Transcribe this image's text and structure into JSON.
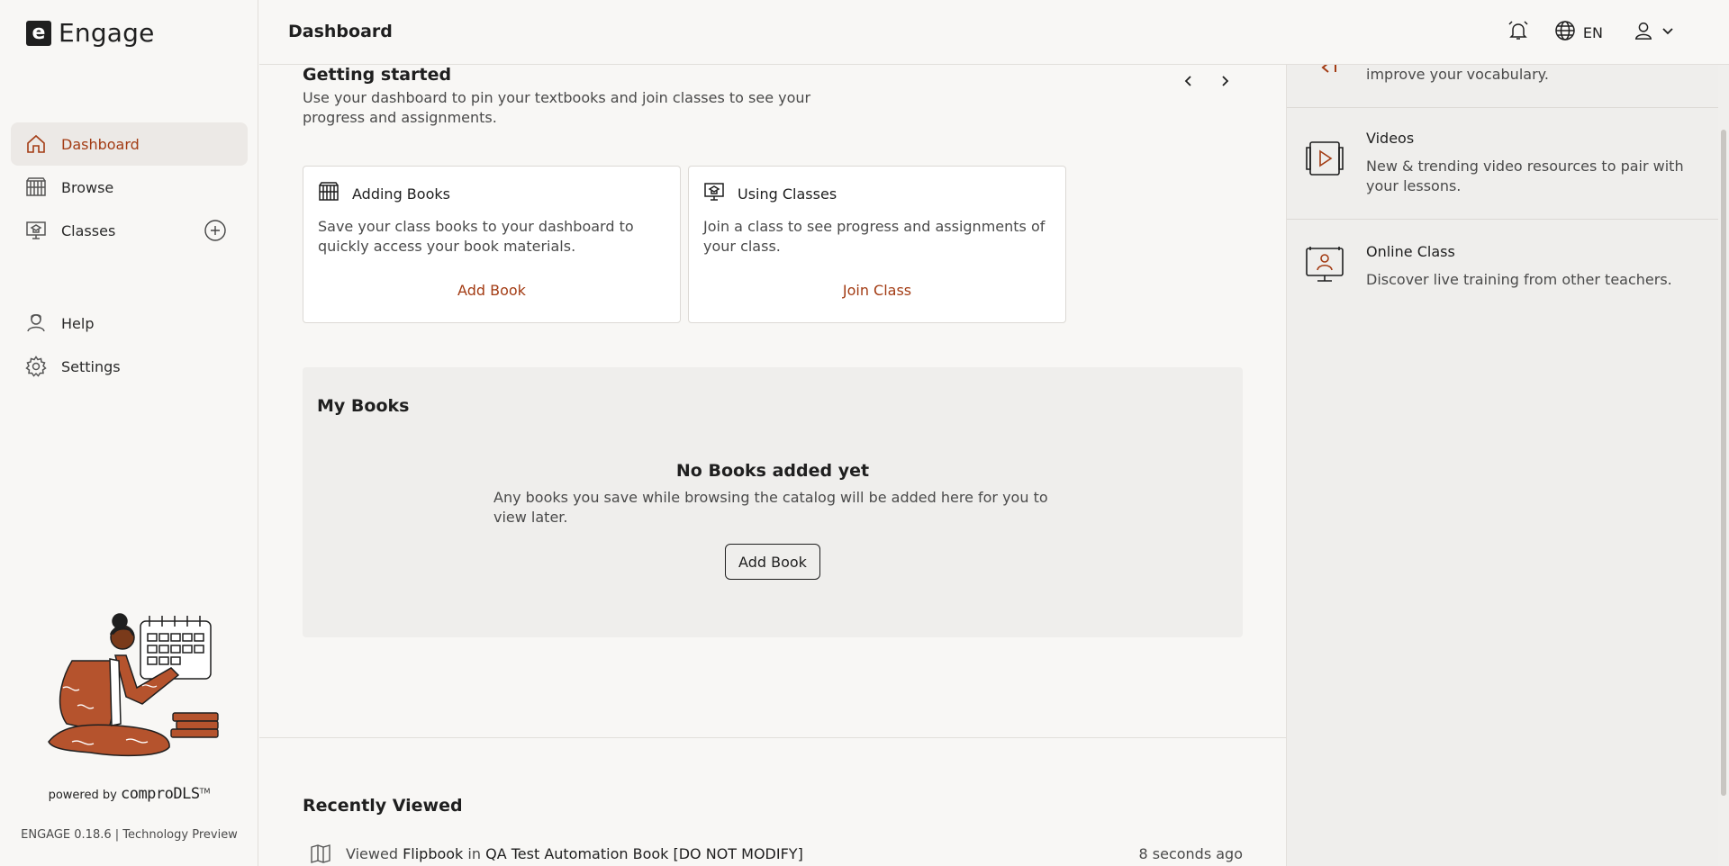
{
  "app": {
    "name": "Engage",
    "logo_letter": "e"
  },
  "header": {
    "title": "Dashboard",
    "language": "EN"
  },
  "sidebar": {
    "items": [
      {
        "label": "Dashboard",
        "active": true
      },
      {
        "label": "Browse"
      },
      {
        "label": "Classes"
      },
      {
        "label": "Help"
      },
      {
        "label": "Settings"
      }
    ],
    "powered_by": "powered by",
    "powered_brand": "comproDLS",
    "powered_tm": "TM",
    "version": "ENGAGE 0.18.6 | Technology Preview"
  },
  "getting_started": {
    "title": "Getting started",
    "description": "Use your dashboard to pin your textbooks and join classes to see your progress and assignments.",
    "cards": [
      {
        "title": "Adding Books",
        "body": "Save your class books to your dashboard to quickly access your book materials.",
        "link": "Add Book"
      },
      {
        "title": "Using Classes",
        "body": "Join a class to see progress and assignments of your class.",
        "link": "Join Class"
      }
    ]
  },
  "my_books": {
    "title": "My Books",
    "empty_title": "No Books added yet",
    "empty_desc": "Any books you save while browsing the catalog will be added here for you to view later.",
    "button": "Add Book"
  },
  "recently_viewed": {
    "title": "Recently Viewed",
    "items": [
      {
        "prefix": "Viewed",
        "resource": "Flipbook",
        "joiner": "in",
        "book": "QA Test Automation Book [DO NOT MODIFY]",
        "time": "8 seconds ago"
      }
    ]
  },
  "resources": [
    {
      "title": "",
      "desc": "improve your vocabulary."
    },
    {
      "title": "Videos",
      "desc": "New & trending video resources to pair with your lessons."
    },
    {
      "title": "Online Class",
      "desc": "Discover live training from other teachers."
    }
  ],
  "colors": {
    "accent": "#a33c14",
    "background": "#f8f7f5",
    "panel": "#efeeec"
  }
}
